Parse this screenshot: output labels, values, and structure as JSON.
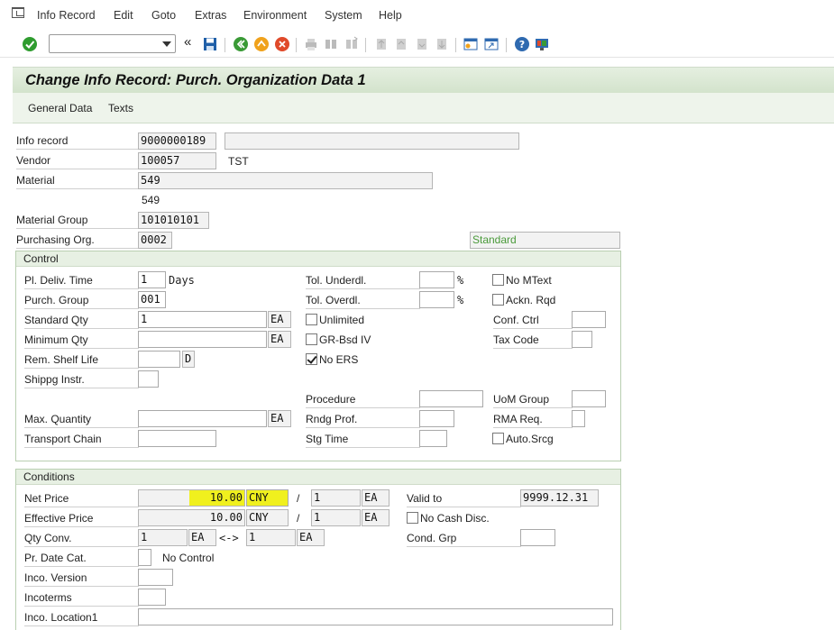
{
  "menu": {
    "items": [
      "Info Record",
      "Edit",
      "Goto",
      "Extras",
      "Environment",
      "System",
      "Help"
    ]
  },
  "toolbar": {
    "command_field_value": ""
  },
  "title": "Change Info Record: Purch. Organization Data 1",
  "app_toolbar": {
    "general_data": "General Data",
    "texts": "Texts"
  },
  "header": {
    "info_record_label": "Info record",
    "info_record_value": "9000000189",
    "info_record_desc": "",
    "vendor_label": "Vendor",
    "vendor_value": "100057",
    "vendor_name": "TST",
    "material_label": "Material",
    "material_value": "549",
    "material_desc": "549",
    "material_group_label": "Material Group",
    "material_group_value": "101010101",
    "purch_org_label": "Purchasing Org.",
    "purch_org_value": "0002",
    "standard_text": "Standard"
  },
  "control": {
    "title": "Control",
    "pl_deliv_time_label": "Pl. Deliv. Time",
    "pl_deliv_time_value": "1",
    "days_text": "Days",
    "tol_underdl_label": "Tol. Underdl.",
    "tol_underdl_value": "",
    "tol_overdl_label": "Tol. Overdl.",
    "tol_overdl_value": "",
    "percent": "%",
    "no_mtext_label": "No MText",
    "ackn_rqd_label": "Ackn. Rqd",
    "purch_group_label": "Purch. Group",
    "purch_group_value": "001",
    "standard_qty_label": "Standard Qty",
    "standard_qty_value": "1",
    "unit": "EA",
    "unlimited_label": "Unlimited",
    "conf_ctrl_label": "Conf. Ctrl",
    "minimum_qty_label": "Minimum Qty",
    "minimum_qty_value": "",
    "gr_bsd_iv_label": "GR-Bsd IV",
    "tax_code_label": "Tax Code",
    "rem_shelf_life_label": "Rem. Shelf Life",
    "rem_shelf_life_unit": "D",
    "no_ers_label": "No ERS",
    "shippg_instr_label": "Shippg Instr.",
    "procedure_label": "Procedure",
    "uom_group_label": "UoM Group",
    "max_quantity_label": "Max. Quantity",
    "rndg_prof_label": "Rndg Prof.",
    "rma_req_label": "RMA Req.",
    "transport_chain_label": "Transport Chain",
    "stg_time_label": "Stg Time",
    "auto_srcg_label": "Auto.Srcg"
  },
  "conditions": {
    "title": "Conditions",
    "net_price_label": "Net Price",
    "net_price_value": "10.00",
    "currency": "CNY",
    "slash": "/",
    "per_value": "1",
    "unit": "EA",
    "valid_to_label": "Valid to",
    "valid_to_value": "9999.12.31",
    "effective_price_label": "Effective Price",
    "effective_price_value": "10.00",
    "no_cash_disc_label": "No Cash Disc.",
    "qty_conv_label": "Qty Conv.",
    "qty_conv_left": "1",
    "arrow": "<->",
    "qty_conv_right": "1",
    "cond_grp_label": "Cond. Grp",
    "pr_date_cat_label": "Pr. Date Cat.",
    "no_control_text": "No Control",
    "inco_version_label": "Inco. Version",
    "incoterms_label": "Incoterms",
    "inco_location1_label": "Inco. Location1"
  },
  "checkbox_states": {
    "no_mtext": false,
    "ackn_rqd": false,
    "unlimited": false,
    "gr_bsd_iv": false,
    "no_ers": true,
    "auto_srcg": false,
    "no_cash_disc": false
  },
  "colors": {
    "title_band": "#d3e3cc",
    "highlight": "#f0f01e",
    "standard_text": "#4a9a3a"
  }
}
